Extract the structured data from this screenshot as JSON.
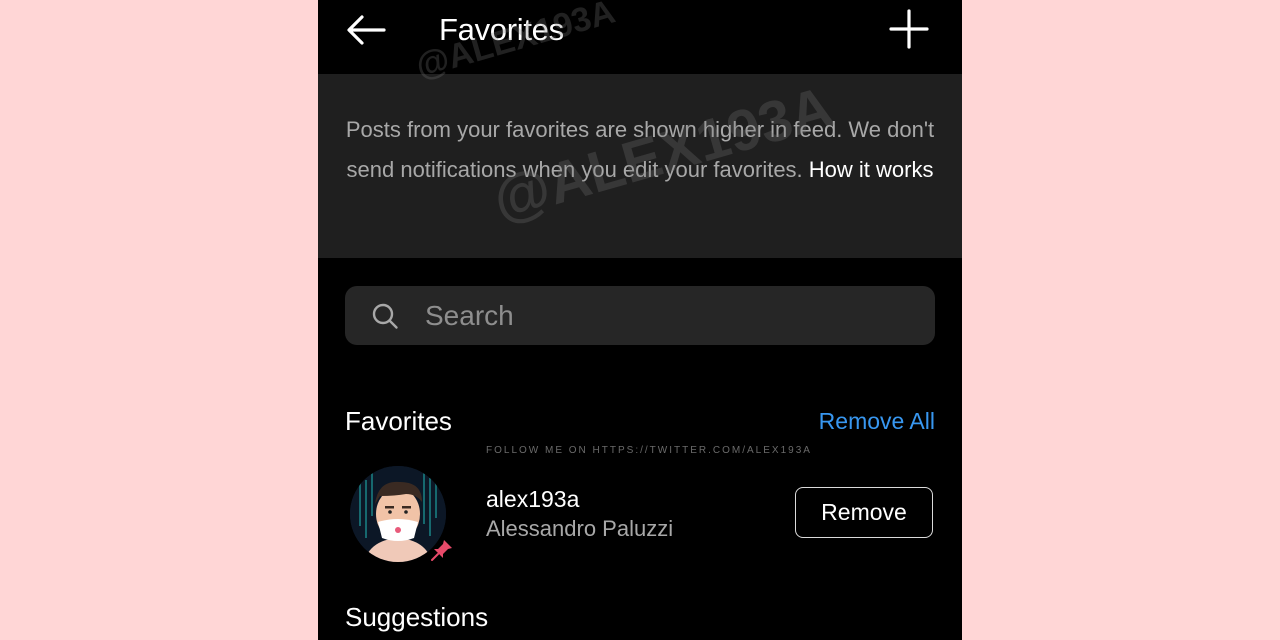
{
  "header": {
    "title": "Favorites",
    "back_icon": "arrow-left-icon",
    "add_icon": "plus-icon"
  },
  "info": {
    "text": "Posts from your favorites are shown higher in feed. We don't send notifications when you edit your favorites.",
    "link_label": "How it works"
  },
  "search": {
    "placeholder": "Search",
    "value": "",
    "icon": "search-icon"
  },
  "favorites_section": {
    "title": "Favorites",
    "remove_all_label": "Remove All",
    "items": [
      {
        "username": "alex193a",
        "full_name": "Alessandro Paluzzi",
        "button_label": "Remove",
        "pin_icon": "pin-icon"
      }
    ]
  },
  "suggestions_section": {
    "title": "Suggestions"
  },
  "watermarks": {
    "small": "FOLLOW ME ON HTTPS://TWITTER.COM/ALEX193A",
    "large_1": "@ALEX193A",
    "large_2": "@ALEX193A"
  },
  "colors": {
    "page_background": "#ffd6d6",
    "screen_background": "#000000",
    "info_background": "#1f1f1f",
    "search_background": "#262626",
    "link_blue": "#3897f0",
    "secondary_text": "#a8a8a8"
  }
}
